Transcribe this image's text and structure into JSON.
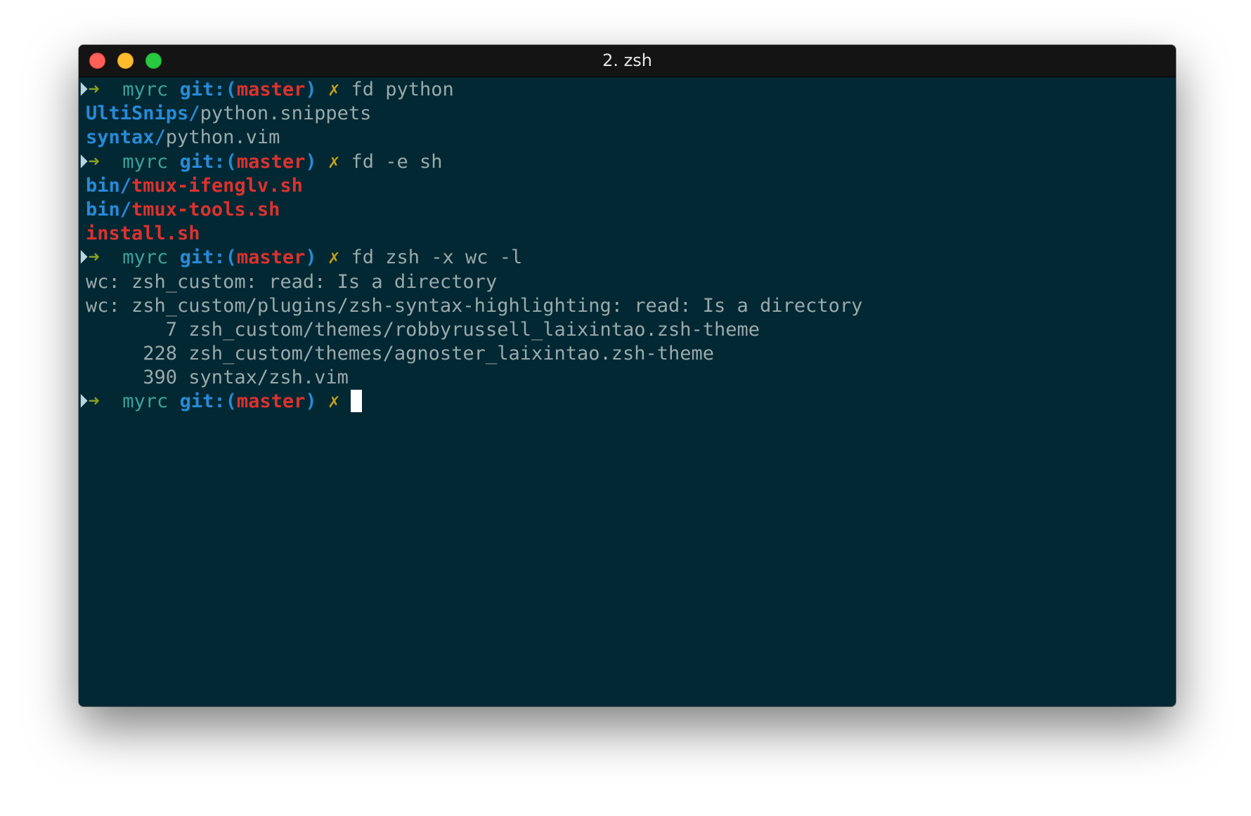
{
  "window": {
    "title": "2. zsh"
  },
  "prompt": {
    "marker": "⏵",
    "arrow": "➜",
    "dir": "myrc",
    "git_open": "git:(",
    "branch": "master",
    "git_close": ")",
    "dirty": "✗"
  },
  "colors": {
    "background": "#022833",
    "titlebar": "#141414",
    "green_arrow": "#869d25",
    "cyan_dir": "#3aa39a",
    "blue": "#288ad6",
    "red": "#dc322f",
    "yellow": "#c5a017",
    "text": "#9aa9ab"
  },
  "session": [
    {
      "command": "fd python"
    },
    {
      "dir": "UltiSnips/",
      "file": "python.snippets"
    },
    {
      "dir": "syntax/",
      "file": "python.vim"
    },
    {
      "command": "fd -e sh"
    },
    {
      "dir": "bin/",
      "file": "tmux-ifenglv.sh"
    },
    {
      "dir": "bin/",
      "file": "tmux-tools.sh"
    },
    {
      "file": "install.sh"
    },
    {
      "command": "fd zsh -x wc -l"
    },
    {
      "text": "wc: zsh_custom: read: Is a directory"
    },
    {
      "text": "wc: zsh_custom/plugins/zsh-syntax-highlighting: read: Is a directory"
    },
    {
      "text": "       7 zsh_custom/themes/robbyrussell_laixintao.zsh-theme"
    },
    {
      "text": "     228 zsh_custom/themes/agnoster_laixintao.zsh-theme"
    },
    {
      "text": "     390 syntax/zsh.vim"
    },
    {
      "command": ""
    }
  ]
}
